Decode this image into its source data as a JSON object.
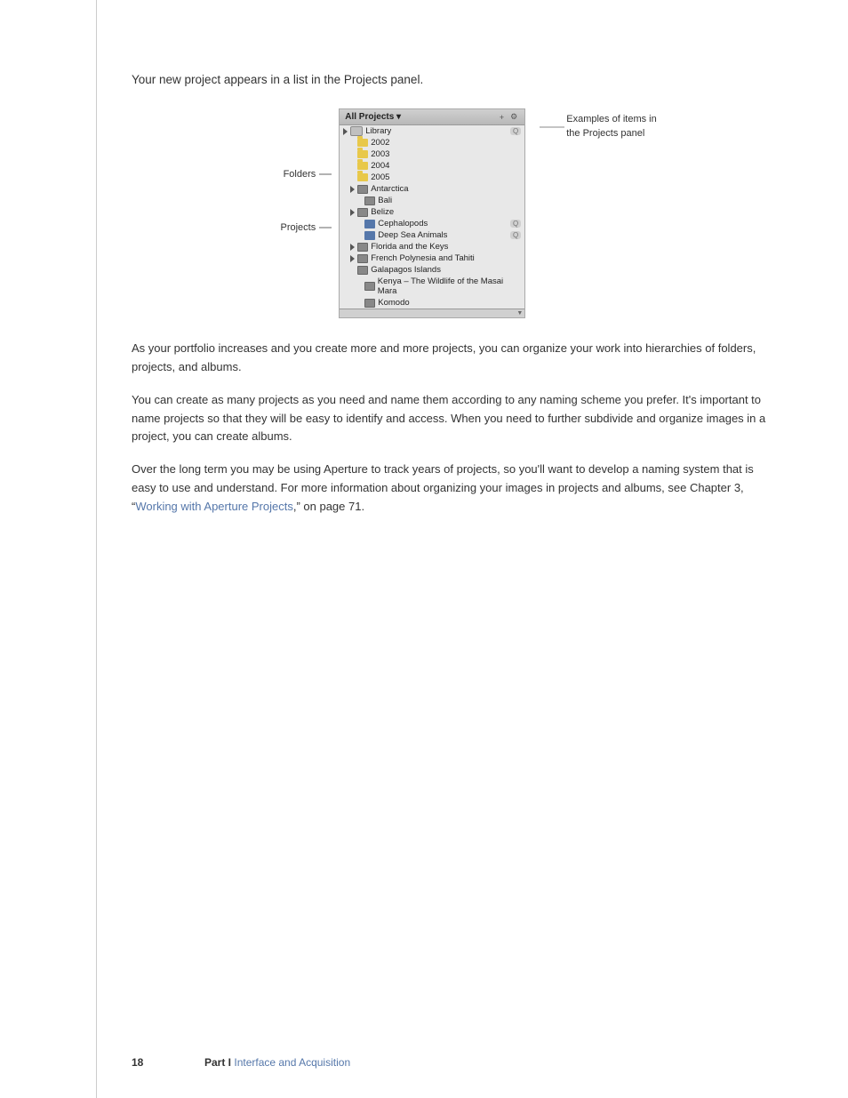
{
  "page": {
    "intro_text": "Your new project appears in a list in the Projects panel.",
    "paragraph1": "As your portfolio increases and you create more and more projects, you can organize your work into hierarchies of folders, projects, and albums.",
    "paragraph2": "You can create as many projects as you need and name them according to any naming scheme you prefer. It's important to name projects so that they will be easy to identify and access. When you need to further subdivide and organize images in a project, you can create albums.",
    "paragraph3_part1": "Over the long term you may be using Aperture to track years of projects, so you'll want to develop a naming system that is easy to use and understand. For more information about organizing your images in projects and albums, see Chapter 3, “",
    "paragraph3_link": "Working with Aperture Projects",
    "paragraph3_part2": ",” on page 71.",
    "panel": {
      "title": "All Projects ▾",
      "header_btn1": "+",
      "header_btn2": "⚙",
      "rows": [
        {
          "indent": 0,
          "has_triangle": true,
          "icon": "library",
          "text": "Library",
          "badge": "Q"
        },
        {
          "indent": 1,
          "has_triangle": false,
          "icon": "folder",
          "text": "2002",
          "badge": ""
        },
        {
          "indent": 1,
          "has_triangle": false,
          "icon": "folder",
          "text": "2003",
          "badge": ""
        },
        {
          "indent": 1,
          "has_triangle": false,
          "icon": "folder",
          "text": "2004",
          "badge": ""
        },
        {
          "indent": 1,
          "has_triangle": false,
          "icon": "folder",
          "text": "2005",
          "badge": ""
        },
        {
          "indent": 1,
          "has_triangle": true,
          "icon": "project",
          "text": "Antarctica",
          "badge": ""
        },
        {
          "indent": 2,
          "has_triangle": false,
          "icon": "project",
          "text": "Bali",
          "badge": ""
        },
        {
          "indent": 1,
          "has_triangle": true,
          "icon": "project",
          "text": "Belize",
          "badge": ""
        },
        {
          "indent": 2,
          "has_triangle": false,
          "icon": "smart",
          "text": "Cephalopods",
          "badge": "Q"
        },
        {
          "indent": 2,
          "has_triangle": false,
          "icon": "smart",
          "text": "Deep Sea Animals",
          "badge": "Q"
        },
        {
          "indent": 1,
          "has_triangle": true,
          "icon": "project",
          "text": "Florida and the Keys",
          "badge": ""
        },
        {
          "indent": 1,
          "has_triangle": true,
          "icon": "project",
          "text": "French Polynesia and Tahiti",
          "badge": ""
        },
        {
          "indent": 1,
          "has_triangle": false,
          "icon": "project",
          "text": "Galapagos Islands",
          "badge": ""
        },
        {
          "indent": 2,
          "has_triangle": false,
          "icon": "project",
          "text": "Kenya – The Wildlife of the Masai Mara",
          "badge": ""
        },
        {
          "indent": 2,
          "has_triangle": false,
          "icon": "project",
          "text": "Komodo",
          "badge": ""
        }
      ]
    },
    "labels": {
      "folders": "Folders",
      "projects": "Projects",
      "folders_dash": "—",
      "projects_dash": "—"
    },
    "annotation": {
      "line1": "Examples of items in",
      "line2": "the Projects panel"
    },
    "footer": {
      "page_number": "18",
      "chapter_text": "Part I    Interface and Acquisition"
    }
  }
}
